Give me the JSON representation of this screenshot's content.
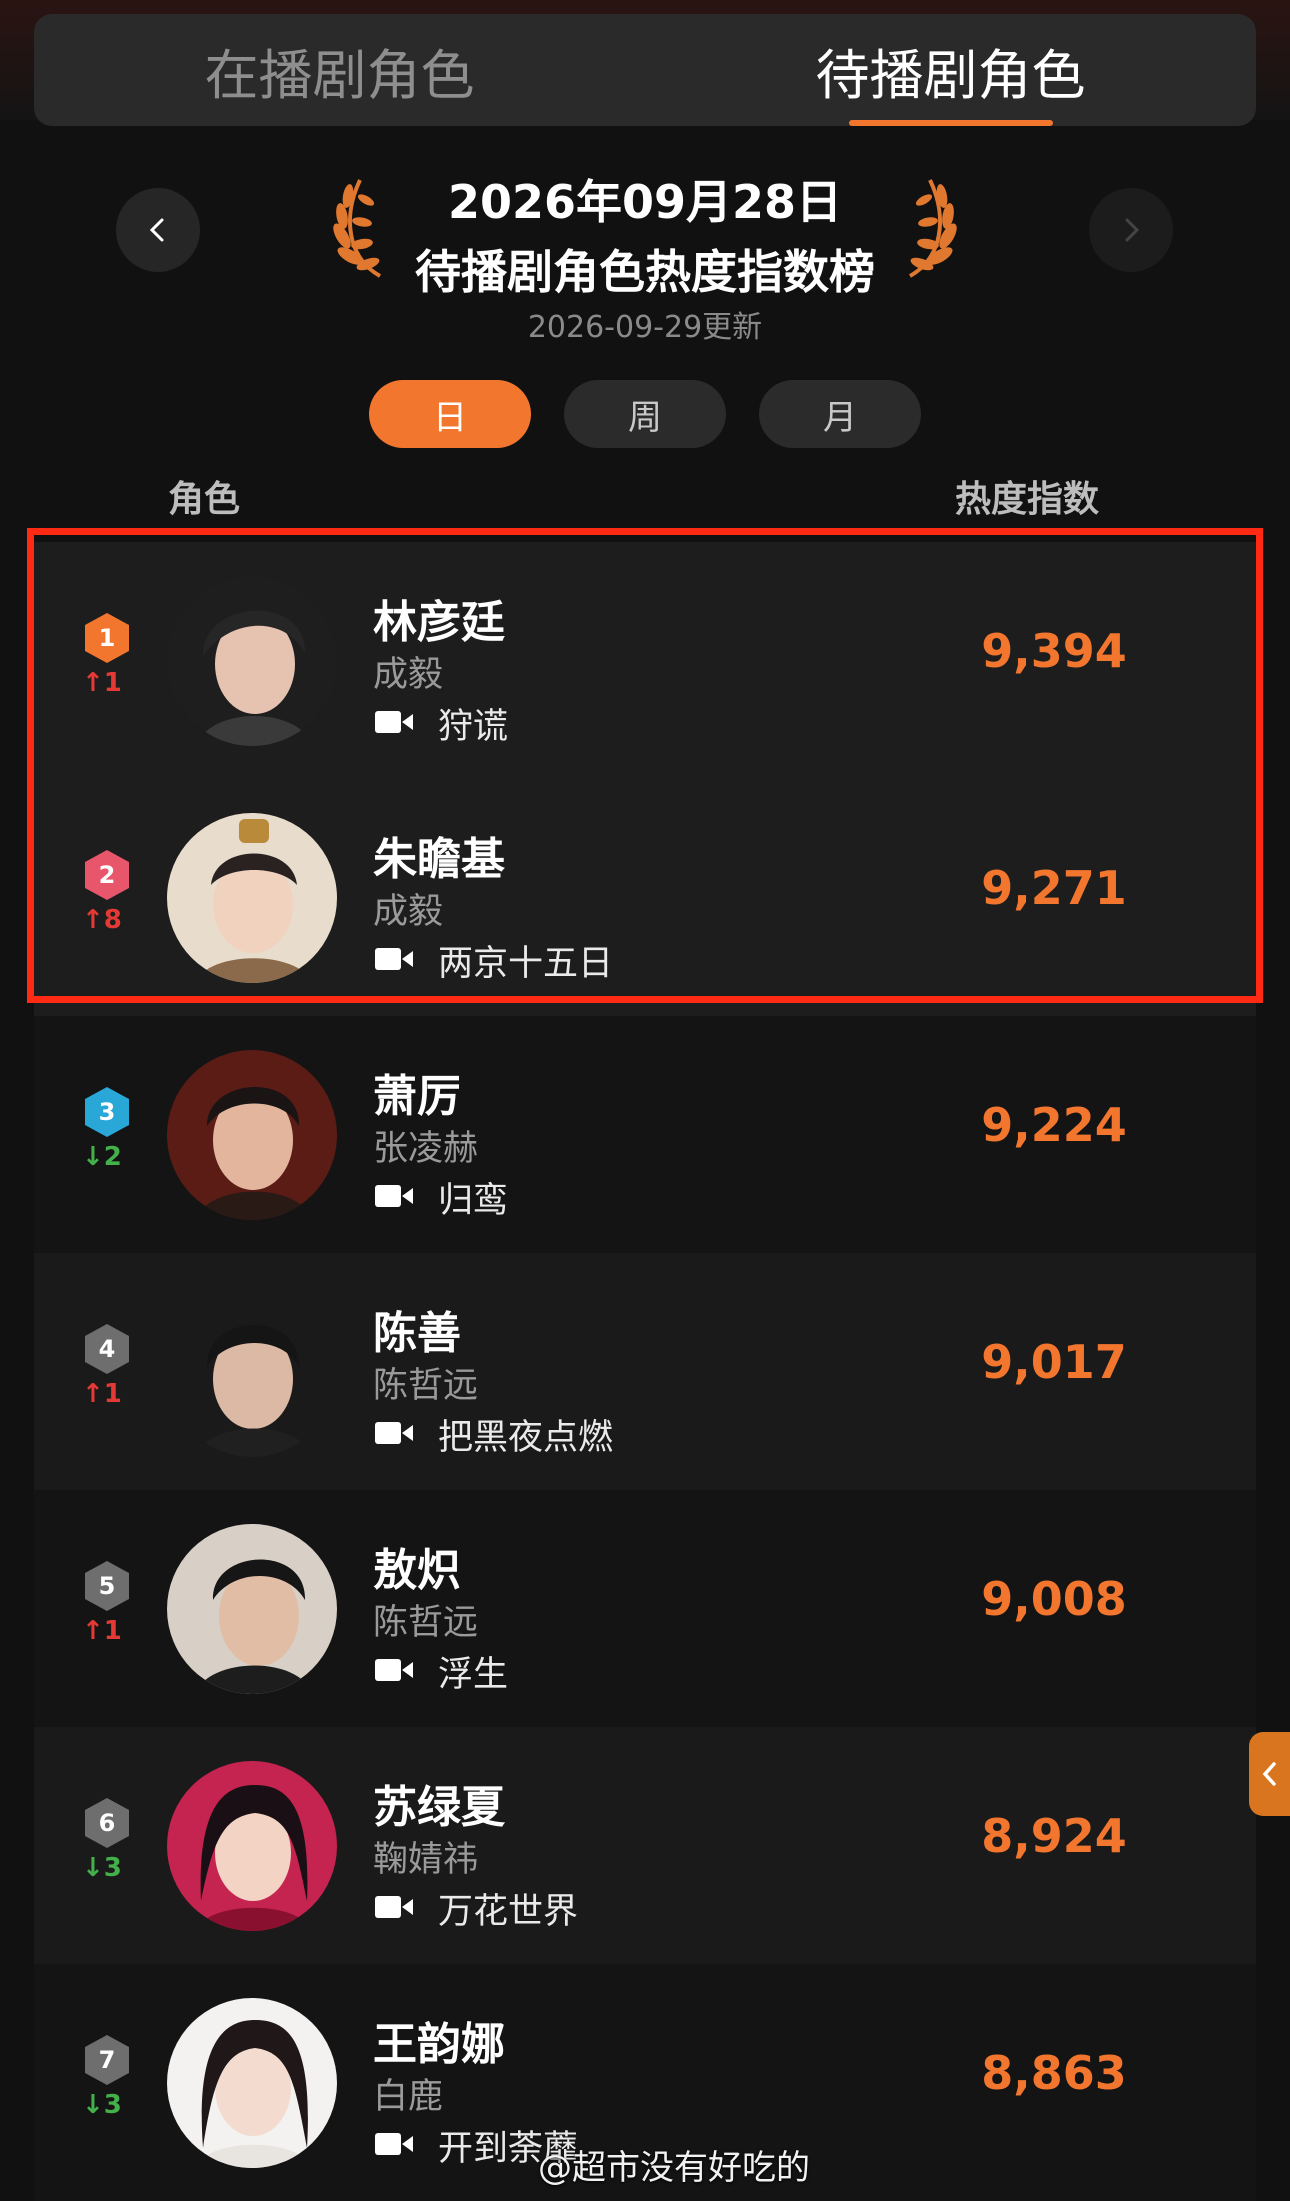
{
  "tabs": [
    {
      "label": "在播剧角色",
      "active": false
    },
    {
      "label": "待播剧角色",
      "active": true
    }
  ],
  "header": {
    "date": "2026年09月28日",
    "title": "待播剧角色热度指数榜",
    "updated": "2026-09-29更新"
  },
  "periods": [
    {
      "label": "日",
      "active": true
    },
    {
      "label": "周",
      "active": false
    },
    {
      "label": "月",
      "active": false
    }
  ],
  "columns": {
    "role": "角色",
    "heat": "热度指数"
  },
  "rows": [
    {
      "rank": "1",
      "change": "1",
      "dir": "up",
      "name": "林彦廷",
      "actor": "成毅",
      "show": "狩谎",
      "score": "9,394"
    },
    {
      "rank": "2",
      "change": "8",
      "dir": "up",
      "name": "朱瞻基",
      "actor": "成毅",
      "show": "两京十五日",
      "score": "9,271"
    },
    {
      "rank": "3",
      "change": "2",
      "dir": "down",
      "name": "萧厉",
      "actor": "张凌赫",
      "show": "归鸾",
      "score": "9,224"
    },
    {
      "rank": "4",
      "change": "1",
      "dir": "up",
      "name": "陈善",
      "actor": "陈哲远",
      "show": "把黑夜点燃",
      "score": "9,017"
    },
    {
      "rank": "5",
      "change": "1",
      "dir": "up",
      "name": "敖炽",
      "actor": "陈哲远",
      "show": "浮生",
      "score": "9,008"
    },
    {
      "rank": "6",
      "change": "3",
      "dir": "down",
      "name": "苏绿夏",
      "actor": "鞠婧祎",
      "show": "万花世界",
      "score": "8,924"
    },
    {
      "rank": "7",
      "change": "3",
      "dir": "down",
      "name": "王韵娜",
      "actor": "白鹿",
      "show": "开到荼蘼",
      "score": "8,863"
    }
  ],
  "colors": {
    "accent": "#f3762f",
    "highlight_border": "#ff2a14",
    "up": "#e53935",
    "down": "#43b04a",
    "rank1": "#f3762f",
    "rank2": "#e8566b",
    "rank3": "#29a8d8",
    "rank_other": "#6e6e6e"
  },
  "watermark": "@超市没有好吃的"
}
